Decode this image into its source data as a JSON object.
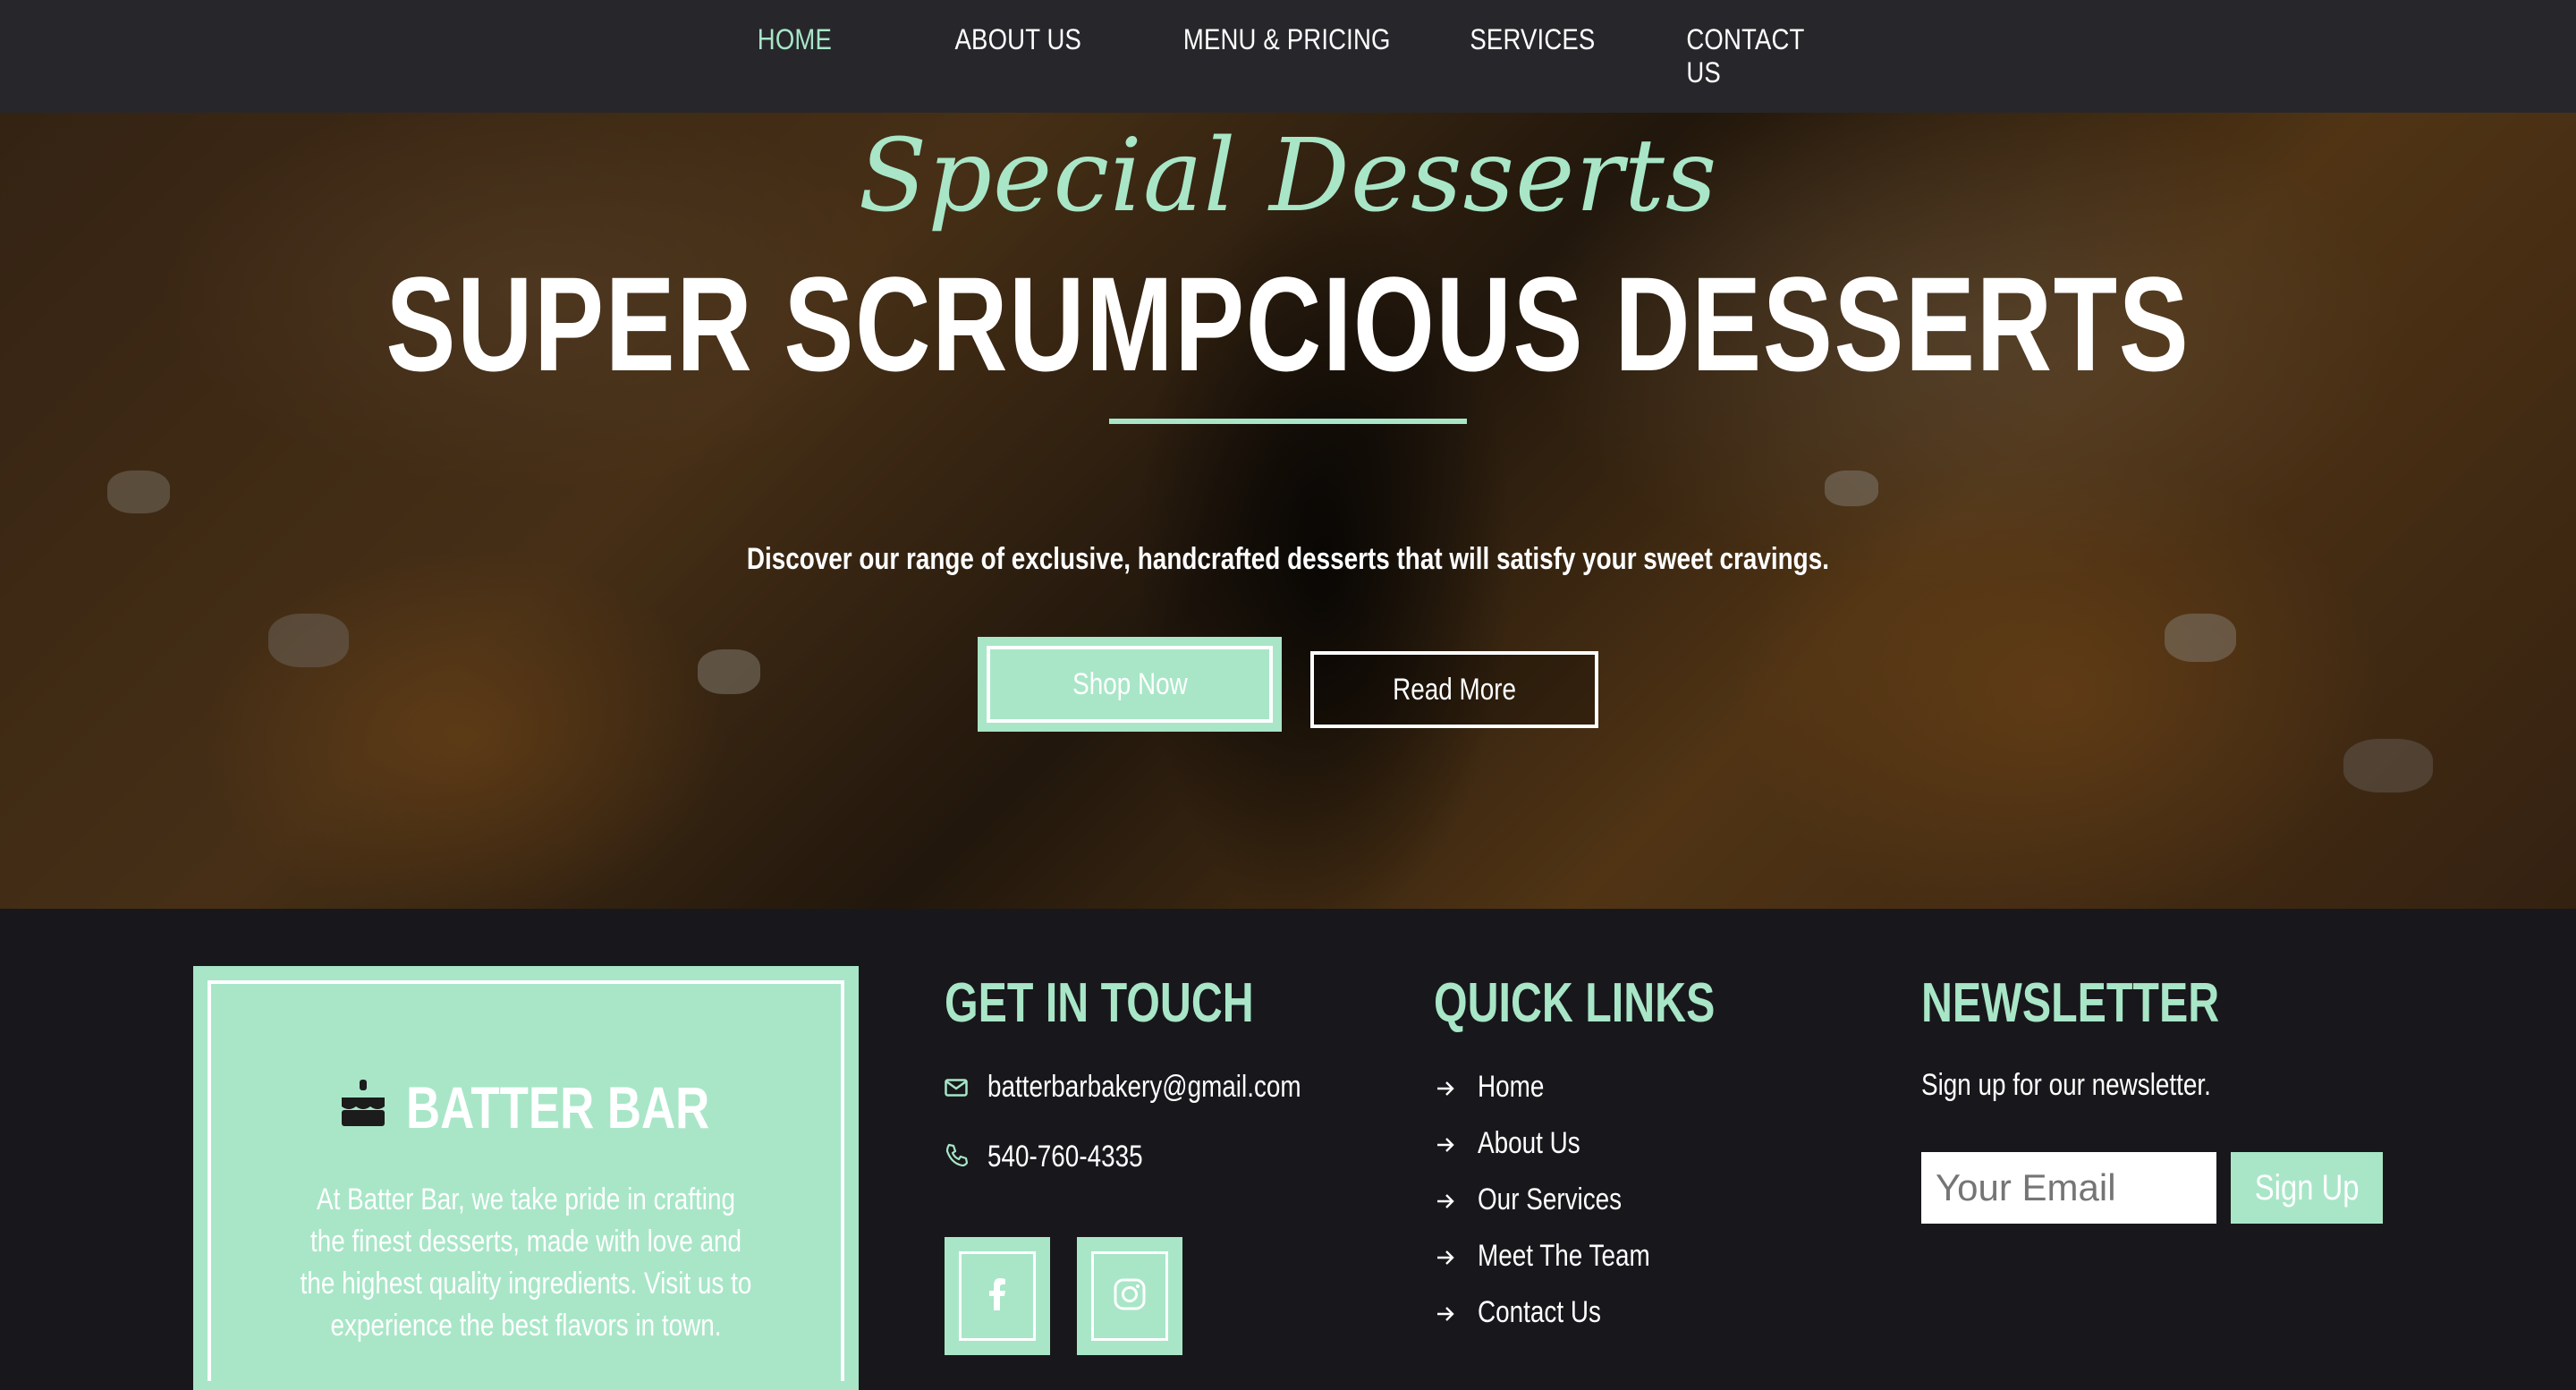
{
  "nav": {
    "items": [
      {
        "label": "HOME",
        "active": true
      },
      {
        "label": "ABOUT US",
        "active": false
      },
      {
        "label": "MENU & PRICING",
        "active": false
      },
      {
        "label": "SERVICES",
        "active": false
      },
      {
        "label": "CONTACT US",
        "active": false
      }
    ]
  },
  "hero": {
    "script_title": "Special Desserts",
    "title": "SUPER SCRUMPCIOUS DESSERTS",
    "subtitle": "Discover our range of exclusive, handcrafted desserts that will satisfy your sweet cravings.",
    "primary_button": "Shop Now",
    "secondary_button": "Read More"
  },
  "brand": {
    "name": "BATTER BAR",
    "icon": "cake-icon",
    "description": "At Batter Bar, we take pride in crafting the finest desserts, made with love and the highest quality ingredients. Visit us to experience the best flavors in town."
  },
  "contact": {
    "title": "GET IN TOUCH",
    "email": "batterbarbakery@gmail.com",
    "phone": "540-760-4335",
    "social": [
      "facebook-icon",
      "instagram-icon"
    ]
  },
  "quick_links": {
    "title": "QUICK LINKS",
    "items": [
      "Home",
      "About Us",
      "Our Services",
      "Meet The Team",
      "Contact Us"
    ]
  },
  "newsletter": {
    "title": "NEWSLETTER",
    "subtitle": "Sign up for our newsletter.",
    "email_placeholder": "Your Email",
    "button": "Sign Up"
  },
  "colors": {
    "accent": "#a8e6c7",
    "nav_bg": "#27272b",
    "footer_bg": "#18181c"
  }
}
